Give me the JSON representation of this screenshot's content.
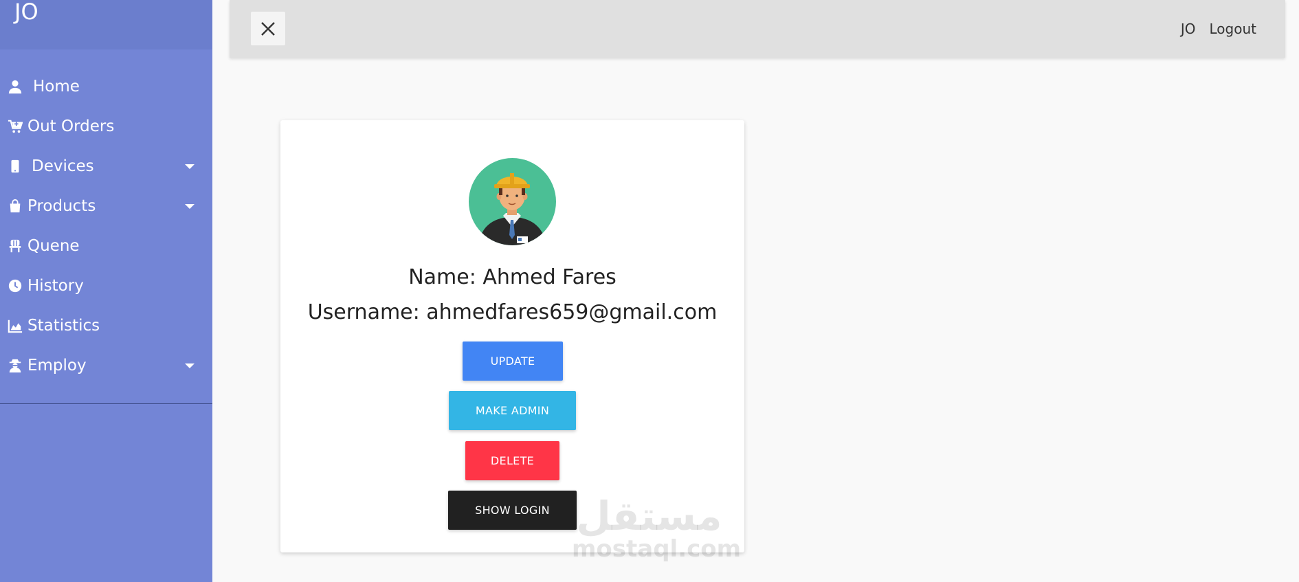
{
  "sidebar": {
    "brand": "JO",
    "items": [
      {
        "label": "Home",
        "icon": "user-icon"
      },
      {
        "label": "Out Orders",
        "icon": "cart-plus-icon"
      },
      {
        "label": "Devices",
        "icon": "mobile-icon",
        "has_submenu": true
      },
      {
        "label": "Products",
        "icon": "shopping-bag-icon",
        "has_submenu": true
      },
      {
        "label": "Quene",
        "icon": "chair-icon"
      },
      {
        "label": "History",
        "icon": "clock-icon"
      },
      {
        "label": "Statistics",
        "icon": "area-chart-icon"
      },
      {
        "label": "Employ",
        "icon": "user-secret-icon",
        "has_submenu": true
      }
    ]
  },
  "header": {
    "close_icon": "close-icon",
    "user_label": "JO",
    "logout_label": "Logout"
  },
  "profile": {
    "name_text": "Name: Ahmed Fares",
    "username_text": "Username: ahmedfares659@gmail.com",
    "buttons": {
      "update": "UPDATE",
      "make_admin": "MAKE ADMIN",
      "delete": "DELETE",
      "show_login": "SHOW LOGIN"
    }
  },
  "watermark": {
    "arabic": "مستقل",
    "latin": "mostaql.com"
  },
  "colors": {
    "sidebar": "#7385d6",
    "update": "#4285f4",
    "make_admin": "#33b5e5",
    "delete": "#ff3547",
    "show_login": "#212121",
    "avatar_bg": "#4bbf95"
  }
}
